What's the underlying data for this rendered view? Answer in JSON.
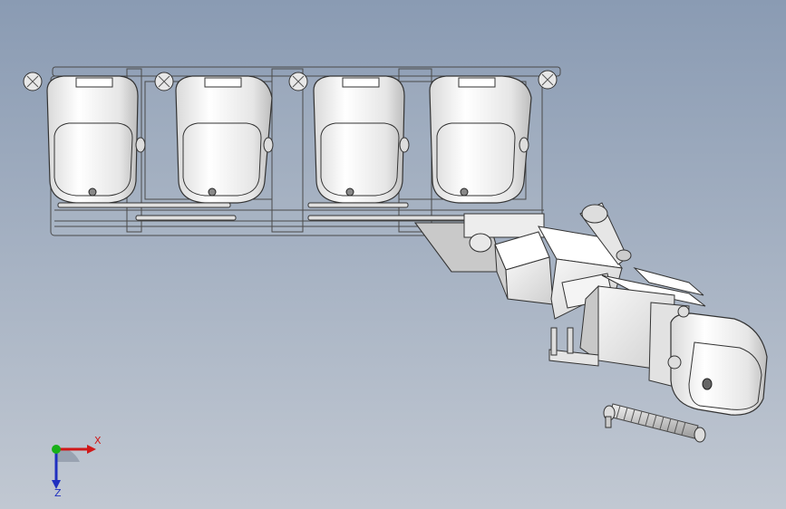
{
  "viewport": {
    "background_top": "#8a9bb3",
    "background_bottom": "#c1c8d2",
    "part_fill": "#f2f2f2",
    "part_shade": "#c8c8c8",
    "edge_color": "#3a3a3a"
  },
  "triad": {
    "x_label": "X",
    "z_label": "Z",
    "x_color": "#d01818",
    "y_color": "#18b018",
    "z_color": "#2030c0"
  }
}
